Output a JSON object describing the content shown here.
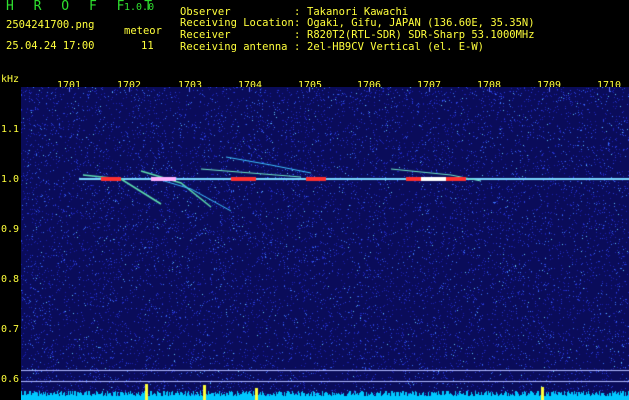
{
  "header": {
    "logo": "H R O F F T",
    "version": "1.0.0",
    "filename": "2504241700.png",
    "datetime": "25.04.24 17:00",
    "type_label": "meteor",
    "count": "11"
  },
  "info": [
    {
      "key": "Observer",
      "sep": ":",
      "value": "Takanori Kawachi"
    },
    {
      "key": "Receiving Location",
      "sep": ":",
      "value": "Ogaki, Gifu, JAPAN (136.60E, 35.35N)"
    },
    {
      "key": "Receiver",
      "sep": ":",
      "value": "R820T2(RTL-SDR) SDR-Sharp 53.1000MHz"
    },
    {
      "key": "Receiving antenna",
      "sep": ":",
      "value": "2el-HB9CV Vertical (el. E-W)"
    }
  ],
  "axis": {
    "unit": "kHz",
    "time_ticks": [
      "1701",
      "1702",
      "1703",
      "1704",
      "1705",
      "1706",
      "1707",
      "1708",
      "1709",
      "1710"
    ],
    "freq_ticks": [
      "1.1",
      "1.0",
      "0.9",
      "0.8",
      "0.7",
      "0.6"
    ]
  },
  "colors": {
    "background": "#000000",
    "noise": "#1e28c8",
    "text_yellow": "#ffff3c",
    "logo_green": "#2fe02f",
    "carrier": "#7ad8ff",
    "echo_red": "#ff3030",
    "baseline": "#00c8ff"
  }
}
